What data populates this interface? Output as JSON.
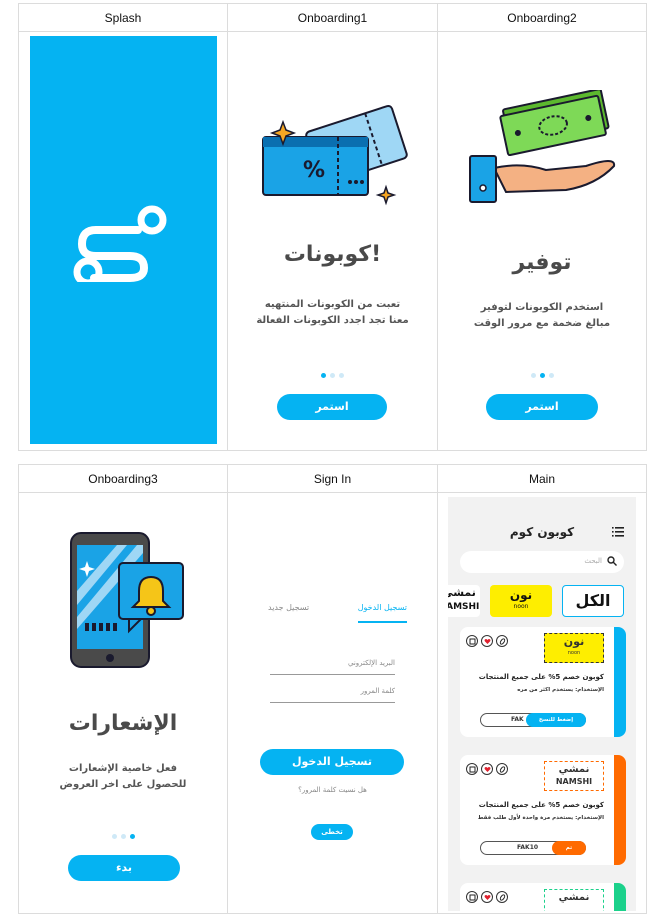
{
  "screens": {
    "splash": {
      "title": "Splash"
    },
    "onboarding1": {
      "title": "Onboarding1",
      "heading": "كوبونات!",
      "line1": "تعبت من الكوبونات المنتهيه",
      "line2": "معنا تجد اجدد الكوبونات الفعالة",
      "button": "استمر"
    },
    "onboarding2": {
      "title": "Onboarding2",
      "heading": "توفير",
      "line1": "استخدم الكوبونات لتوفير",
      "line2": "مبالغ ضخمة مع مرور الوقت",
      "button": "استمر"
    },
    "onboarding3": {
      "title": "Onboarding3",
      "heading": "الإشعارات",
      "line1": "فعل خاصية الإشعارات",
      "line2": "للحصول على اخر العروض",
      "button": "بدء"
    },
    "signin": {
      "title": "Sign In",
      "tab_login": "تسجيل الدخول",
      "tab_register": "تسجيل جديد",
      "email_label": "البريد الإلكتروني",
      "password_label": "كلمة المرور",
      "login_button": "تسجيل الدخول",
      "forgot": "هل نسيت كلمة المرور؟",
      "skip_button": "تخطى"
    },
    "main": {
      "title": "Main",
      "app_title": "كوبون كوم",
      "search_placeholder": "البحث",
      "brands": {
        "all": "الكل",
        "noon": "نون",
        "noon_latin": "noon",
        "namshi": "نمشي",
        "namshi_latin": "NAMSHI"
      },
      "coupons": [
        {
          "brand": "نون",
          "brand_latin": "noon",
          "title": "كوبون خصم 5% على جميع المنتجات",
          "subtitle": "الإستخدام: يستخدم اكثر من مره",
          "code": "FAK",
          "action": "إضغط للنسخ",
          "accent": "#05b3f2"
        },
        {
          "brand": "نمشي",
          "brand_latin": "NAMSHI",
          "title": "كوبون خصم 5% على جميع المنتجات",
          "subtitle": "الإستخدام: يستخدم مرة واحدة لأول طلب فقط",
          "code": "FAK10",
          "action": "تم النسخ",
          "accent": "#ff6a00"
        },
        {
          "brand": "نمشي",
          "brand_latin": "",
          "title": "",
          "subtitle": "",
          "code": "",
          "action": "",
          "accent": "#1bd18b"
        }
      ]
    }
  },
  "colors": {
    "primary": "#05b3f2",
    "orange": "#ff6a00",
    "green": "#1bd18b",
    "noon_yellow": "#feee00"
  }
}
